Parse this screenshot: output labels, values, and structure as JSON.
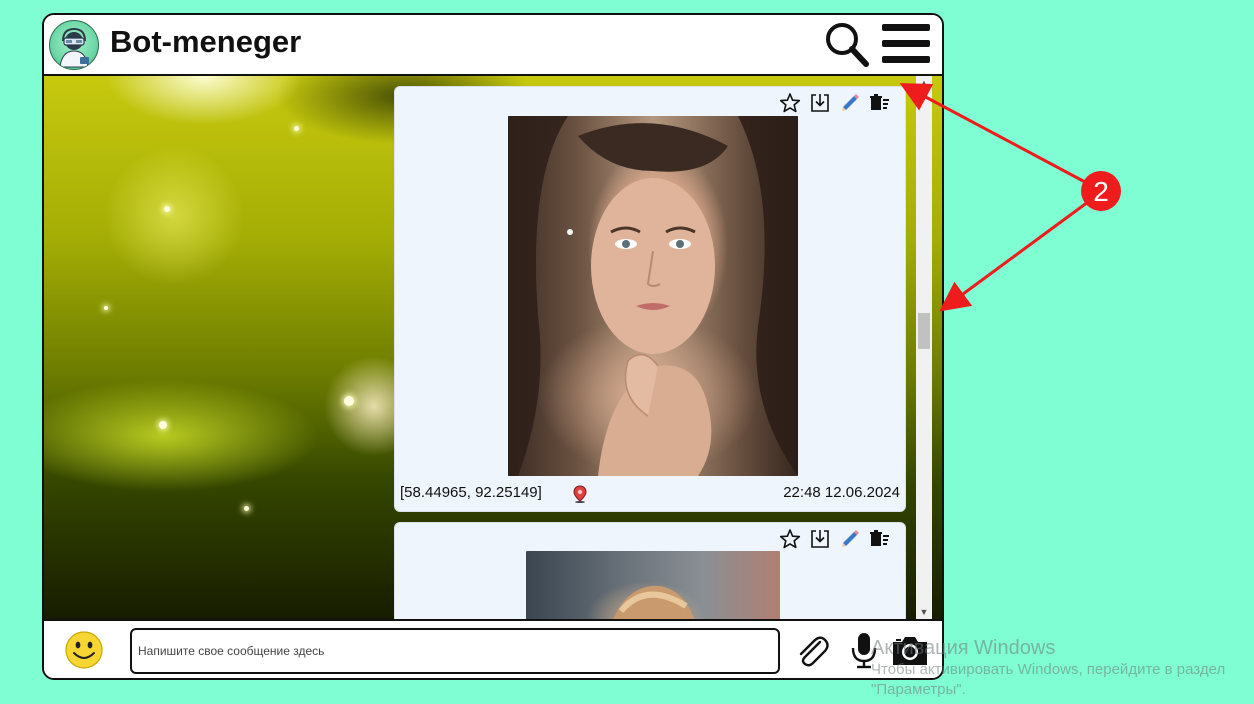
{
  "header": {
    "title": "Bot-meneger",
    "avatar_icon": "robot-avatar-icon",
    "search_icon": "search-icon",
    "menu_icon": "hamburger-menu-icon"
  },
  "messages": [
    {
      "actions": [
        "star-icon",
        "download-icon",
        "pencil-icon",
        "delete-icon"
      ],
      "photo": "portrait-photo",
      "coords": "[58.44965, 92.25149]",
      "location_icon": "map-pin-icon",
      "time": "22:48 12.06.2024"
    },
    {
      "actions": [
        "star-icon",
        "download-icon",
        "pencil-icon",
        "delete-icon"
      ],
      "photo": "portrait-photo"
    }
  ],
  "input": {
    "placeholder": "Напишите свое сообщение здесь",
    "value": ""
  },
  "annotation": {
    "label": "2",
    "color": "#ee1c1c"
  },
  "windows_watermark": {
    "title": "Активация Windows",
    "subtitle": "Чтобы активировать Windows, перейдите в раздел \"Параметры\"."
  },
  "colors": {
    "page_background": "#7ffed3",
    "message_background": "#eef5fc"
  }
}
